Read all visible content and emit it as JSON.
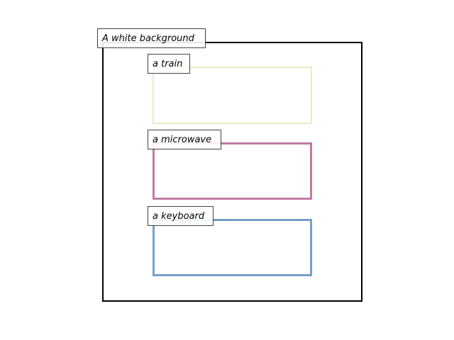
{
  "background": {
    "label": "A white background",
    "color": "#000000"
  },
  "objects": [
    {
      "id": "train",
      "label": "a train",
      "color": "#e2efc4"
    },
    {
      "id": "microwave",
      "label": "a microwave",
      "color": "#c17aa8"
    },
    {
      "id": "keyboard",
      "label": "a keyboard",
      "color": "#739fcb"
    }
  ]
}
